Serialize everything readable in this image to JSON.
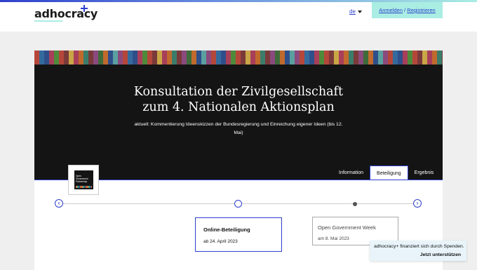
{
  "header": {
    "logo_text": "adhocracy",
    "language": "de",
    "login": {
      "label_login": "Anmelden",
      "separator": " / ",
      "label_register": "Registrieren"
    }
  },
  "project": {
    "title_line1": "Konsultation der Zivilgesellschaft",
    "title_line2": "zum 4. Nationalen Aktionsplan",
    "subtitle": "aktuell: Kommentierung Ideenskizzen der Bundesregierung und Einreichung eigener Ideen (bis 12. Mai)",
    "organisation_logo_text": "Open Government Partnership"
  },
  "tabs": [
    {
      "label": "Information",
      "active": false
    },
    {
      "label": "Beteiligung",
      "active": true
    },
    {
      "label": "Ergebnis",
      "active": false
    }
  ],
  "timeline": {
    "prev_icon": "chevron-left-icon",
    "next_icon": "chevron-right-icon",
    "phases": [
      {
        "title": "Online-Beteiligung",
        "date": "ab 24. April 2023",
        "active": true
      },
      {
        "title": "Open Government Week",
        "date": "am 8. Mai 2023",
        "active": false
      }
    ]
  },
  "donation": {
    "text": "adhocracy+ finanziert sich durch Spenden.",
    "button": "Jetzt unterstützen"
  },
  "colors": {
    "accent": "#2d40cc",
    "mint": "#a9ede3",
    "hero_bg": "#141414"
  }
}
